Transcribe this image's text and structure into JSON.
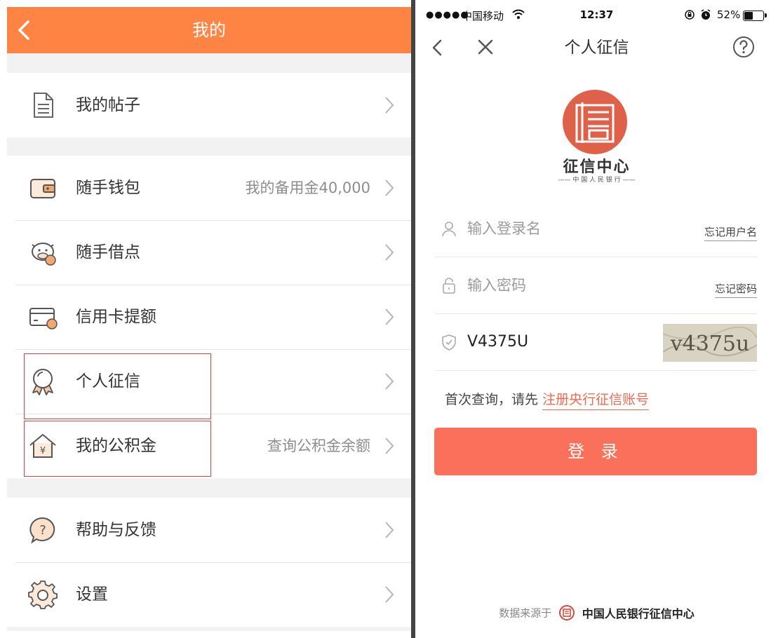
{
  "left": {
    "header": {
      "title": "我的"
    },
    "groups": [
      {
        "items": [
          {
            "label": "我的帖子",
            "value": ""
          }
        ]
      },
      {
        "items": [
          {
            "label": "随手钱包",
            "value": "我的备用金40,000"
          },
          {
            "label": "随手借点",
            "value": ""
          },
          {
            "label": "信用卡提额",
            "value": ""
          },
          {
            "label": "个人征信",
            "value": ""
          },
          {
            "label": "我的公积金",
            "value": "查询公积金余额"
          }
        ]
      },
      {
        "items": [
          {
            "label": "帮助与反馈",
            "value": ""
          },
          {
            "label": "设置",
            "value": ""
          }
        ]
      }
    ],
    "icons": [
      "document-icon",
      "wallet-icon",
      "cow-icon",
      "credit-card-icon",
      "medal-icon",
      "house-yuan-icon",
      "help-bubble-icon",
      "gear-icon"
    ],
    "colors": {
      "header": "#fe8444",
      "highlight": "#d8423c"
    }
  },
  "right": {
    "status_bar": {
      "signal": "●●●●●",
      "carrier": "中国移动",
      "time": "12:37",
      "battery": "52%",
      "battery_level": 0.52
    },
    "nav": {
      "title": "个人征信"
    },
    "logo": {
      "name": "征信中心",
      "subtitle": "—— 中 国 人 民 银 行 ——"
    },
    "form": {
      "username_placeholder": "输入登录名",
      "forgot_username": "忘记用户名",
      "password_placeholder": "输入密码",
      "forgot_password": "忘记密码",
      "captcha_value": "V4375U",
      "captcha_image_text": "v4375u"
    },
    "first_query": {
      "text": "首次查询，请先",
      "link": "注册央行征信账号"
    },
    "login_button": "登 录",
    "footer": {
      "source": "数据来源于",
      "brand": "中国人民银行征信中心"
    },
    "colors": {
      "button": "#fa705a",
      "link": "#f26a50",
      "logo": "#e0614a"
    }
  }
}
